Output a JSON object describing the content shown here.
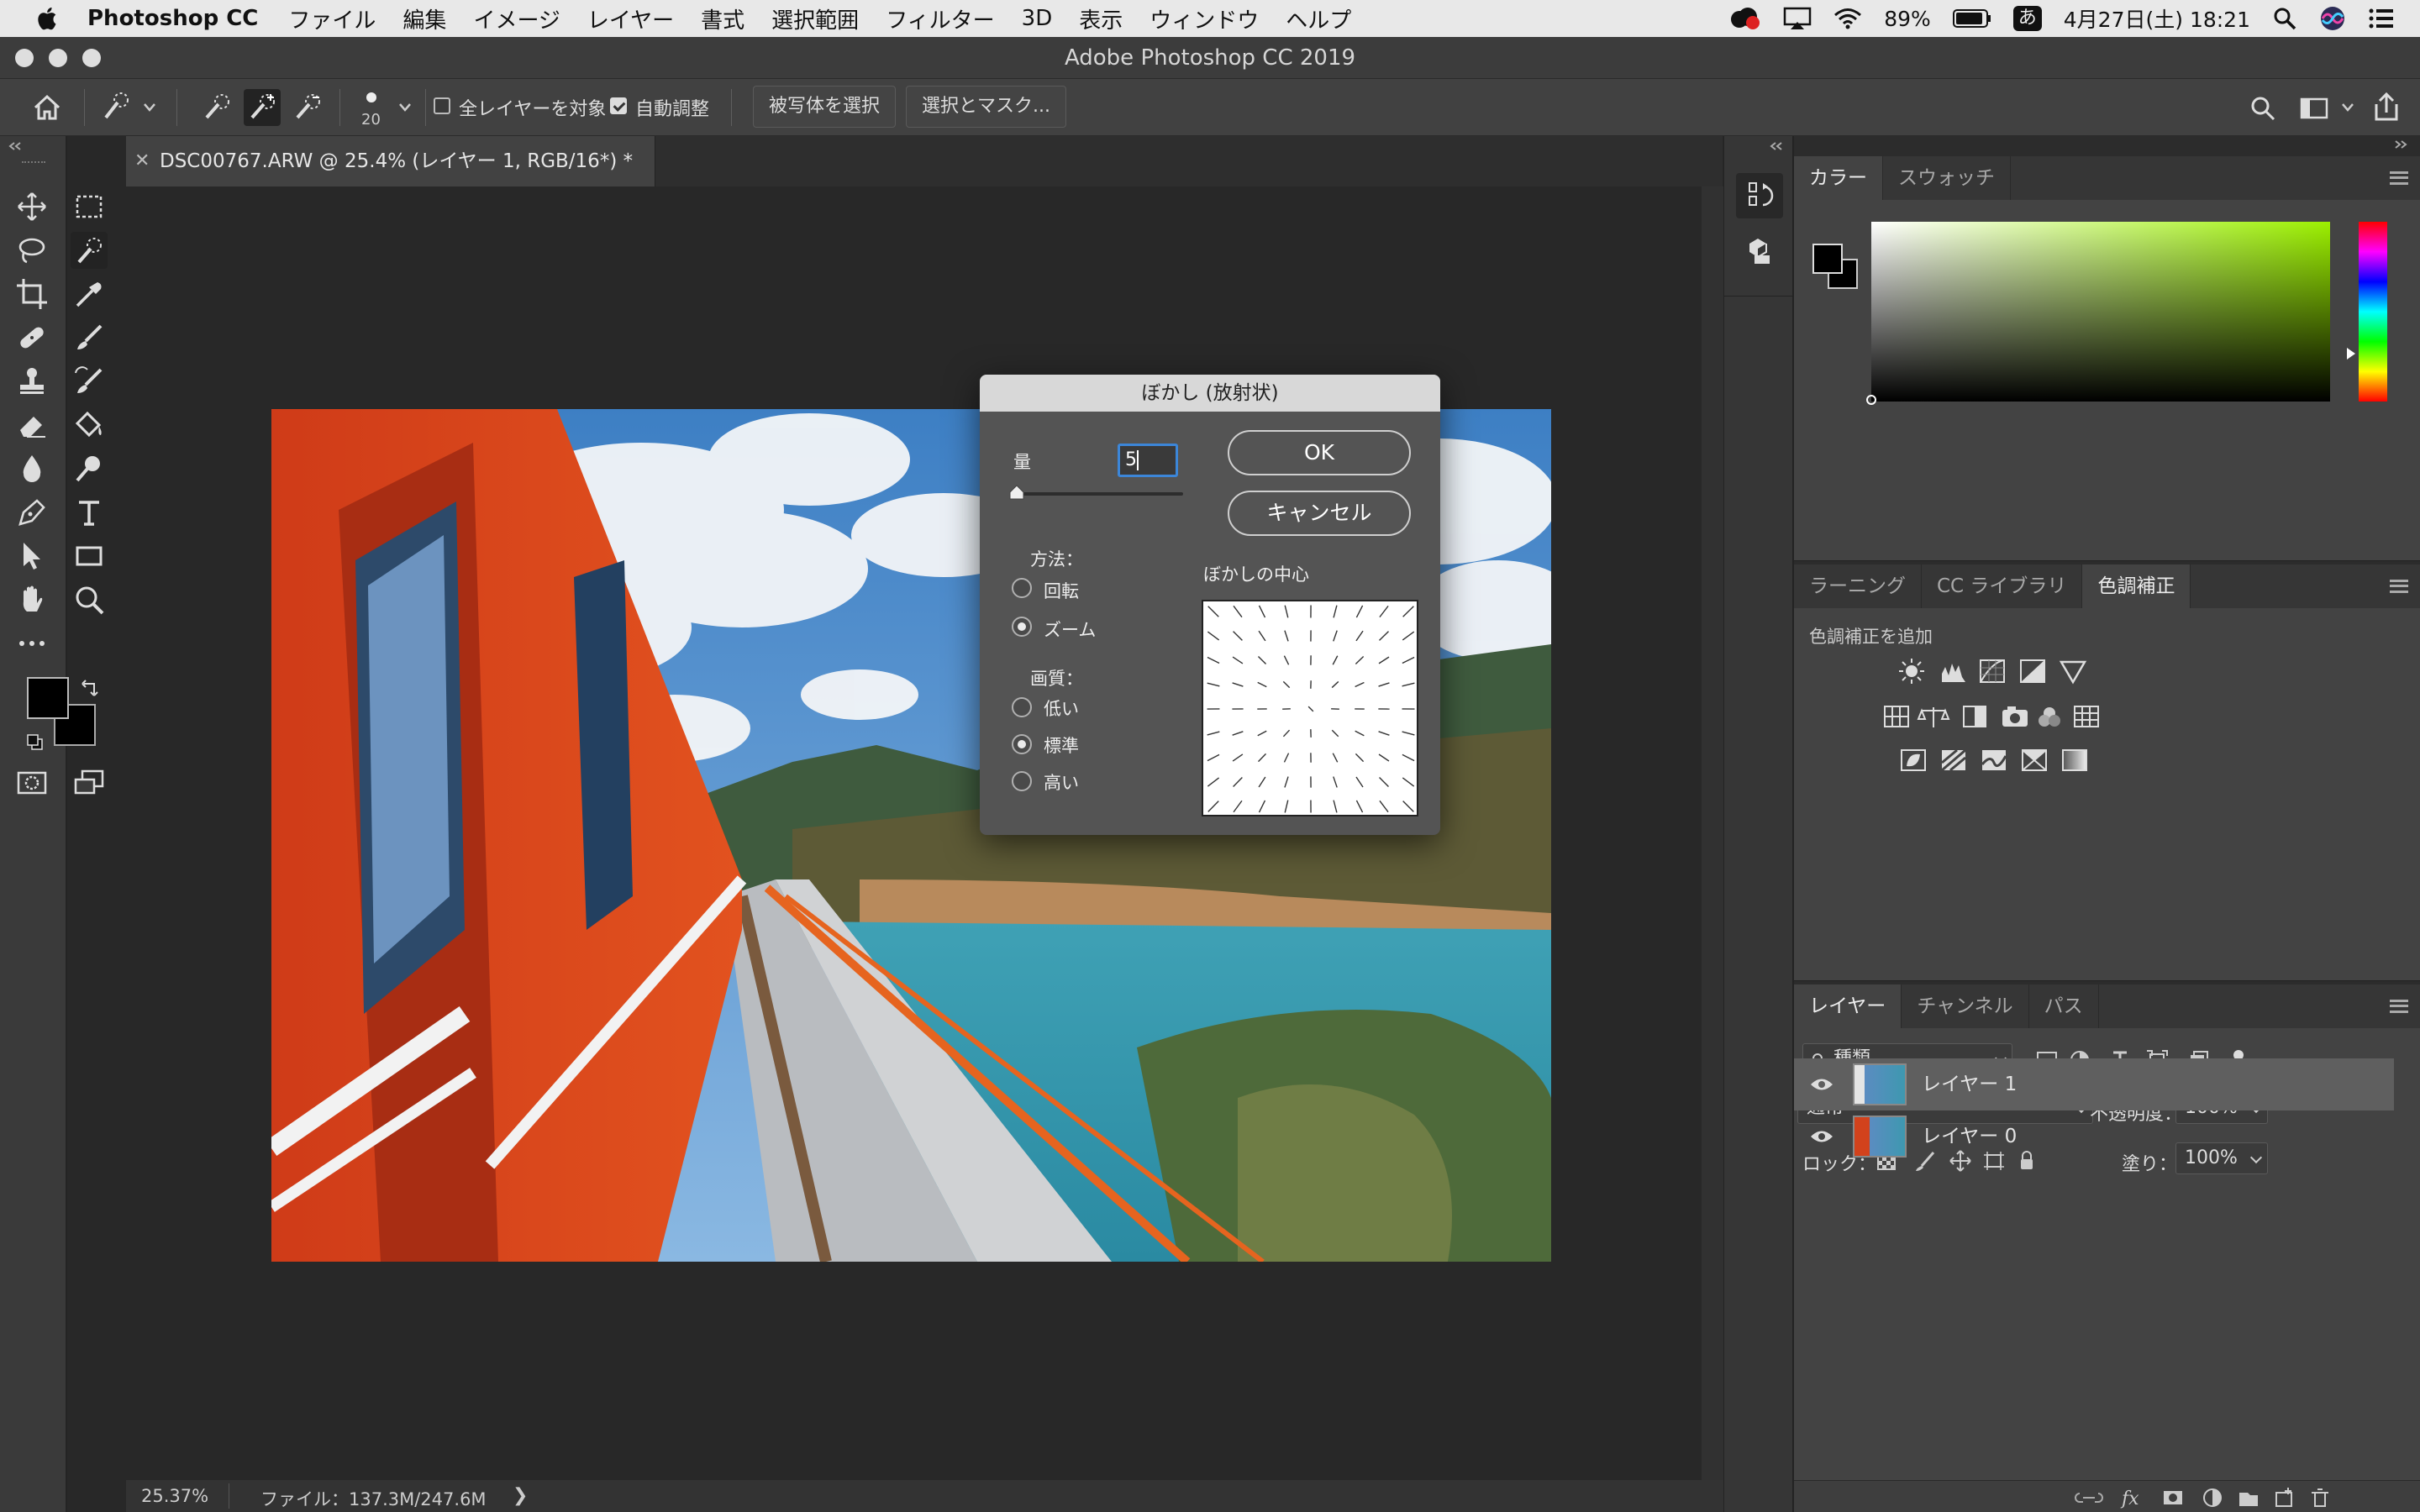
{
  "menubar": {
    "app_name": "Photoshop CC",
    "items": [
      "ファイル",
      "編集",
      "イメージ",
      "レイヤー",
      "書式",
      "選択範囲",
      "フィルター",
      "3D",
      "表示",
      "ウィンドウ",
      "ヘルプ"
    ],
    "battery": "89%",
    "ime": "あ",
    "datetime": "4月27日(土)  18:21"
  },
  "window": {
    "title": "Adobe Photoshop CC 2019"
  },
  "options_bar": {
    "brush_size": "20",
    "sample_all_layers": "全レイヤーを対象",
    "sample_all_checked": false,
    "auto_enhance": "自動調整",
    "auto_enhance_checked": true,
    "select_subject": "被写体を選択",
    "select_and_mask": "選択とマスク..."
  },
  "document": {
    "tab_title": "DSC00767.ARW @ 25.4% (レイヤー 1, RGB/16*) *",
    "zoom": "25.37%",
    "file_info": "ファイル：137.3M/247.6M"
  },
  "dialog": {
    "title": "ぼかし (放射状)",
    "amount_label": "量",
    "amount_value": "5",
    "amount_fraction": 0.0,
    "ok": "OK",
    "cancel": "キャンセル",
    "method_label": "方法：",
    "methods": [
      "回転",
      "ズーム"
    ],
    "method_selected": "ズーム",
    "quality_label": "画質：",
    "qualities": [
      "低い",
      "標準",
      "高い"
    ],
    "quality_selected": "標準",
    "center_label": "ぼかしの中心"
  },
  "color_panel": {
    "tabs": [
      "カラー",
      "スウォッチ"
    ],
    "active_tab": "カラー",
    "hue_color": "#9cf000"
  },
  "adjustments_panel": {
    "tabs": [
      "ラーニング",
      "CC ライブラリ",
      "色調補正"
    ],
    "active_tab": "色調補正",
    "add_label": "色調補正を追加"
  },
  "layers_panel": {
    "tabs": [
      "レイヤー",
      "チャンネル",
      "パス"
    ],
    "active_tab": "レイヤー",
    "filter_kind": "種類",
    "blend_mode": "通常",
    "opacity_label": "不透明度：",
    "opacity": "100%",
    "lock_label": "ロック：",
    "fill_label": "塗り：",
    "fill": "100%",
    "layers": [
      {
        "name": "レイヤー 1",
        "selected": true
      },
      {
        "name": "レイヤー 0",
        "selected": false
      }
    ]
  }
}
